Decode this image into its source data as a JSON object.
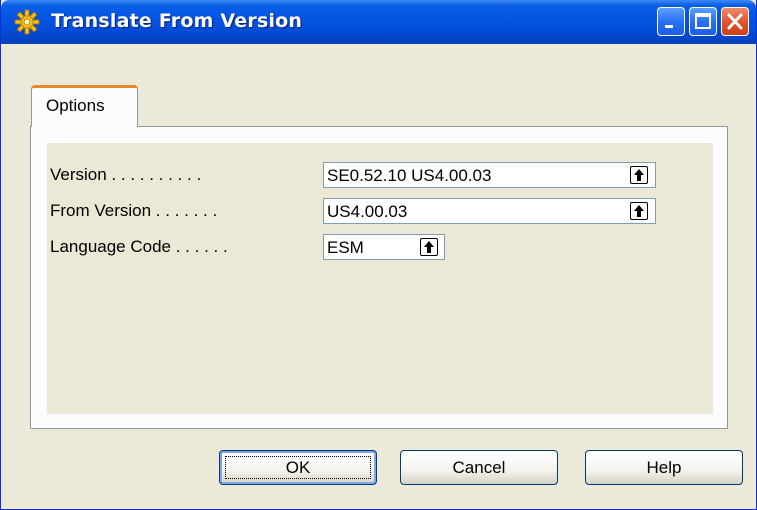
{
  "window": {
    "title": "Translate From Version",
    "icons": [
      "gear-icon",
      "minimize-icon",
      "maximize-icon",
      "close-icon"
    ]
  },
  "tabs": [
    {
      "label": "Options",
      "selected": true
    }
  ],
  "fields": {
    "version": {
      "label": "Version . . . . . . . . . .",
      "value": "SE0.52.10 US4.00.03"
    },
    "from_version": {
      "label": "From Version . . . . . . .",
      "value": "US4.00.03"
    },
    "language_code": {
      "label": "Language Code . . . . . .",
      "value": "ESM"
    }
  },
  "buttons": {
    "ok": "OK",
    "cancel": "Cancel",
    "help": "Help"
  },
  "colors": {
    "titlebar": "#0554e3",
    "tab_accent": "#e68b2c",
    "dialog_bg": "#ece9d8",
    "close_button": "#e0562f"
  }
}
